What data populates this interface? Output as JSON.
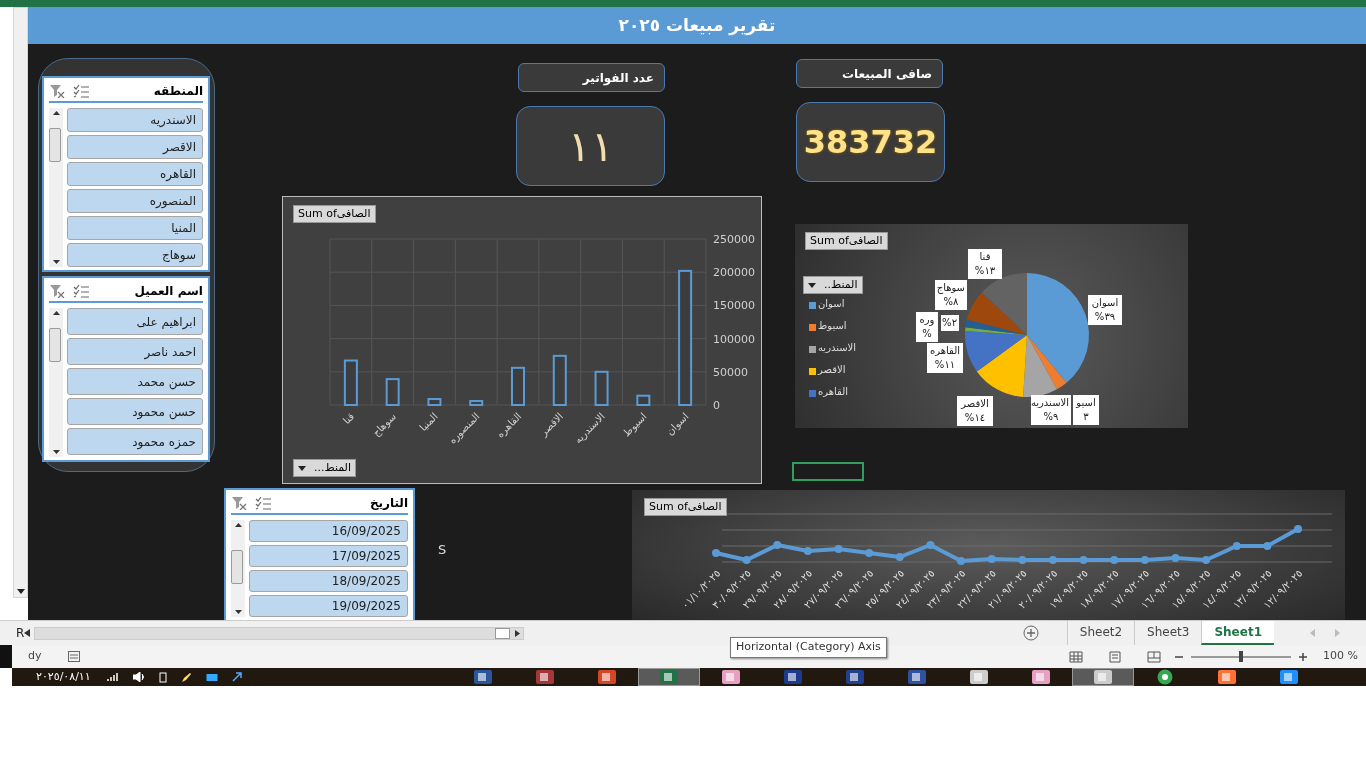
{
  "title": "تقرير مبيعات ٢٠٢٥",
  "slicers": [
    {
      "title": "المنطقه",
      "items": [
        {
          "label": "الاسندريه",
          "selected": true
        },
        {
          "label": "الاقصر",
          "selected": true
        },
        {
          "label": "القاهره",
          "selected": true
        },
        {
          "label": "المنصوره",
          "selected": true
        },
        {
          "label": "المنيا",
          "selected": true
        },
        {
          "label": "سوهاج",
          "selected": true
        }
      ]
    },
    {
      "title": "اسم العميل",
      "items": [
        {
          "label": "ابراهيم على",
          "selected": true
        },
        {
          "label": "احمد ناصر",
          "selected": true
        },
        {
          "label": "حسن محمد",
          "selected": true
        },
        {
          "label": "حسن محمود",
          "selected": true
        },
        {
          "label": "حمزه محمود",
          "selected": true
        }
      ]
    },
    {
      "title": "التاريخ",
      "items": [
        {
          "label": "16/09/2025",
          "selected": true
        },
        {
          "label": "17/09/2025",
          "selected": true
        },
        {
          "label": "18/09/2025",
          "selected": true
        },
        {
          "label": "19/09/2025",
          "selected": true
        }
      ]
    }
  ],
  "kpis": [
    {
      "label": "صافى المبيعات",
      "value": "383732"
    },
    {
      "label": "عدد الفواتير",
      "value": "١١"
    }
  ],
  "cell_text": "S",
  "bar_chart": {
    "field_button": "المنط...",
    "chart_data": {
      "type": "bar",
      "categories": [
        "قنا",
        "سوهاج",
        "المنيا",
        "المنصوره",
        "القاهره",
        "الاقصر",
        "الاسندريه",
        "اسيوط",
        "اسوان"
      ],
      "series": [
        {
          "name": "Sum ofالصافى",
          "color": "#5b9bd5",
          "values": [
            67000,
            39000,
            9000,
            6000,
            56000,
            74000,
            50000,
            14000,
            202000
          ]
        }
      ],
      "ylim": [
        0,
        250000
      ],
      "grid": true,
      "yticks": [
        0,
        50000,
        100000,
        150000,
        200000,
        250000
      ]
    }
  },
  "pie_chart": {
    "value_button": "Sum ofالصافى",
    "field_button": "المنط..",
    "legend": [
      {
        "label": "اسوان",
        "color": "#5b9bd5"
      },
      {
        "label": "اسيوط",
        "color": "#ed7d31"
      },
      {
        "label": "الاسندريه",
        "color": "#a5a5a5"
      },
      {
        "label": "الاقصر",
        "color": "#ffc000"
      },
      {
        "label": "القاهره",
        "color": "#4472c4"
      }
    ],
    "slice_labels": [
      {
        "name": "قنا",
        "value": "١٣%"
      },
      {
        "name": "سوهاج",
        "value": "٨%"
      },
      {
        "name": "اسوان",
        "value": "٣٩%"
      },
      {
        "value": "٢%"
      },
      {
        "name": "وره",
        "value": "%"
      },
      {
        "name": "القاهره",
        "value": "١١%"
      },
      {
        "name": "اسيو",
        "value": "٣"
      },
      {
        "name": "الاسندريه",
        "value": "٩%"
      },
      {
        "name": "الاقصر",
        "value": "١٤%"
      }
    ],
    "chart_data": {
      "type": "pie",
      "values": [
        39,
        3,
        9,
        14,
        11,
        1,
        2,
        8,
        13
      ],
      "colors": [
        "#5b9bd5",
        "#ed7d31",
        "#a5a5a5",
        "#ffc000",
        "#4472c4",
        "#70ad47",
        "#255e91",
        "#9e480e",
        "#636363"
      ]
    }
  },
  "line_chart": {
    "value_button": "Sum ofالصافى",
    "x_labels": [
      "٠١/١٠/٢٠٢٥",
      "٣٠/٠٩/٢٠٢٥",
      "٢٩/٠٩/٢٠٢٥",
      "٢٨/٠٩/٢٠٢٥",
      "٢٧/٠٩/٢٠٢٥",
      "٢٦/٠٩/٢٠٢٥",
      "٢٥/٠٩/٢٠٢٥",
      "٢٤/٠٩/٢٠٢٥",
      "٢٣/٠٩/٢٠٢٥",
      "٢٢/٠٩/٢٠٢٥",
      "٢١/٠٩/٢٠٢٥",
      "٢٠/٠٩/٢٠٢٥",
      "١٩/٠٩/٢٠٢٥",
      "١٨/٠٩/٢٠٢٥",
      "١٧/٠٩/٢٠٢٥",
      "١٦/٠٩/٢٠٢٥",
      "١٥/٠٩/٢٠٢٥",
      "١٤/٠٩/٢٠٢٥",
      "١٣/٠٩/٢٠٢٥",
      "١٢/٠٩/٢٠٢٥"
    ]
  },
  "name_box": "R",
  "sheet_tabs": [
    {
      "label": "Sheet1",
      "selected": true
    },
    {
      "label": "Sheet3",
      "selected": false
    },
    {
      "label": "Sheet2",
      "selected": false
    }
  ],
  "status": {
    "mode": "dy",
    "zoom": "100 %"
  },
  "zoom_slider": {
    "level": 0.5
  },
  "tooltip": "Horizontal (Category) Axis",
  "taskbar": {
    "date": "٢٠٢٥/٠٨/١١",
    "apps": [
      {
        "highlighted": false
      },
      {
        "highlighted": false
      },
      {
        "highlighted": false
      },
      {
        "highlighted": true
      },
      {
        "highlighted": false
      },
      {
        "highlighted": false
      },
      {
        "highlighted": false
      },
      {
        "highlighted": false
      },
      {
        "highlighted": false
      },
      {
        "highlighted": false
      },
      {
        "highlighted": true
      },
      {
        "highlighted": false
      },
      {
        "highlighted": false
      },
      {
        "highlighted": false
      }
    ]
  }
}
